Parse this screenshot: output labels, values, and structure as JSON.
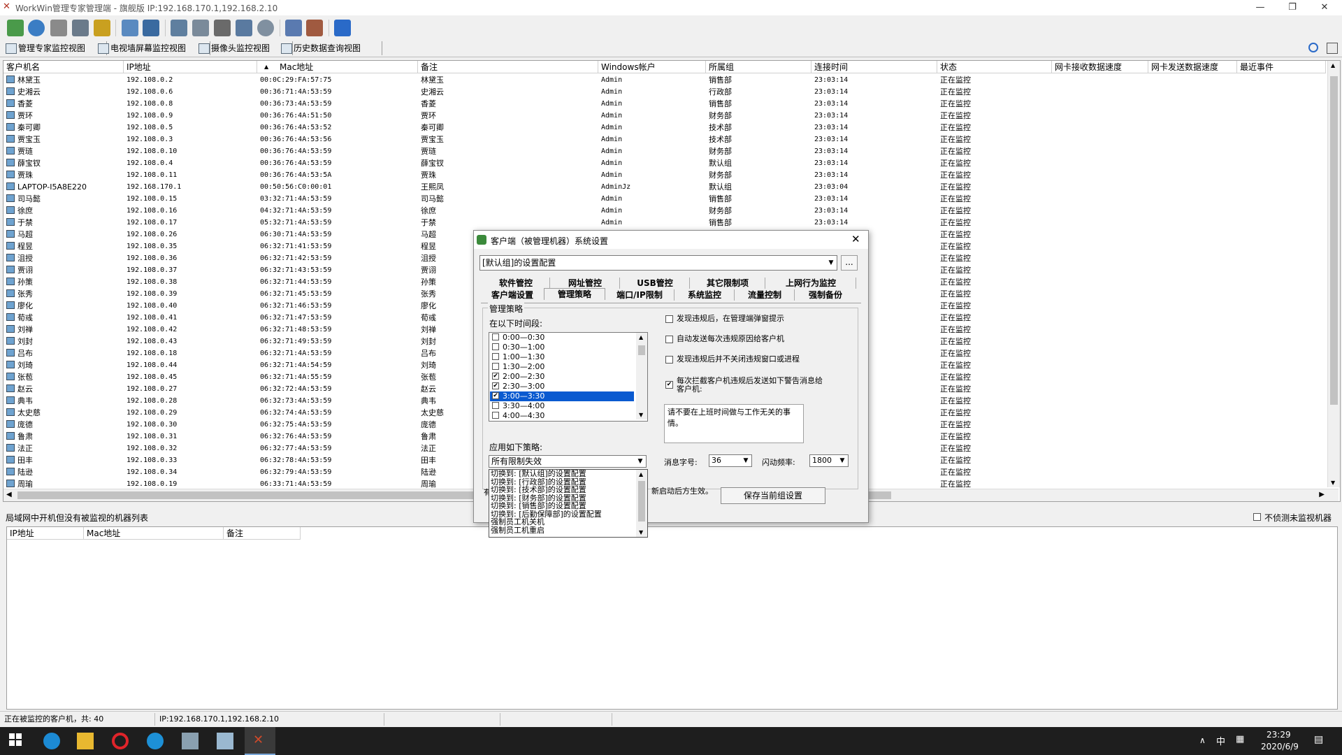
{
  "window": {
    "title": "WorkWin管理专家管理端 - 旗舰版 IP:192.168.170.1,192.168.2.10"
  },
  "view_tabs": [
    "管理专家监控视图",
    "电视墙屏幕监控视图",
    "摄像头监控视图",
    "历史数据查询视图"
  ],
  "columns": [
    "客户机名",
    "IP地址",
    "Mac地址",
    "备注",
    "Windows帐户",
    "所属组",
    "连接时间",
    "状态",
    "网卡接收数据速度",
    "网卡发送数据速度",
    "最近事件"
  ],
  "rows": [
    [
      "林黛玉",
      "192.108.0.2",
      "00:0C:29:FA:57:75",
      "林黛玉",
      "Admin",
      "销售部",
      "23:03:14",
      "正在监控"
    ],
    [
      "史湘云",
      "192.108.0.6",
      "00:36:71:4A:53:59",
      "史湘云",
      "Admin",
      "行政部",
      "23:03:14",
      "正在监控"
    ],
    [
      "香菱",
      "192.108.0.8",
      "00:36:73:4A:53:59",
      "香菱",
      "Admin",
      "销售部",
      "23:03:14",
      "正在监控"
    ],
    [
      "贾环",
      "192.108.0.9",
      "00:36:76:4A:51:50",
      "贾环",
      "Admin",
      "财务部",
      "23:03:14",
      "正在监控"
    ],
    [
      "秦可卿",
      "192.108.0.5",
      "00:36:76:4A:53:52",
      "秦可卿",
      "Admin",
      "技术部",
      "23:03:14",
      "正在监控"
    ],
    [
      "贾宝玉",
      "192.108.0.3",
      "00:36:76:4A:53:56",
      "贾宝玉",
      "Admin",
      "技术部",
      "23:03:14",
      "正在监控"
    ],
    [
      "贾琏",
      "192.108.0.10",
      "00:36:76:4A:53:59",
      "贾琏",
      "Admin",
      "财务部",
      "23:03:14",
      "正在监控"
    ],
    [
      "薛宝钗",
      "192.108.0.4",
      "00:36:76:4A:53:59",
      "薛宝钗",
      "Admin",
      "默认组",
      "23:03:14",
      "正在监控"
    ],
    [
      "贾珠",
      "192.108.0.11",
      "00:36:76:4A:53:5A",
      "贾珠",
      "Admin",
      "财务部",
      "23:03:14",
      "正在监控"
    ],
    [
      "LAPTOP-I5A8E220",
      "192.168.170.1",
      "00:50:56:C0:00:01",
      "王熙凤",
      "AdminJz",
      "默认组",
      "23:03:04",
      "正在监控"
    ],
    [
      "司马懿",
      "192.108.0.15",
      "03:32:71:4A:53:59",
      "司马懿",
      "Admin",
      "销售部",
      "23:03:14",
      "正在监控"
    ],
    [
      "徐庶",
      "192.108.0.16",
      "04:32:71:4A:53:59",
      "徐庶",
      "Admin",
      "财务部",
      "23:03:14",
      "正在监控"
    ],
    [
      "于禁",
      "192.108.0.17",
      "05:32:71:4A:53:59",
      "于禁",
      "Admin",
      "销售部",
      "23:03:14",
      "正在监控"
    ],
    [
      "马超",
      "192.108.0.26",
      "06:30:71:4A:53:59",
      "马超",
      "",
      "",
      "",
      "正在监控"
    ],
    [
      "程昱",
      "192.108.0.35",
      "06:32:71:41:53:59",
      "程昱",
      "",
      "",
      "",
      "正在监控"
    ],
    [
      "沮授",
      "192.108.0.36",
      "06:32:71:42:53:59",
      "沮授",
      "",
      "",
      "",
      "正在监控"
    ],
    [
      "贾诩",
      "192.108.0.37",
      "06:32:71:43:53:59",
      "贾诩",
      "",
      "",
      "",
      "正在监控"
    ],
    [
      "孙策",
      "192.108.0.38",
      "06:32:71:44:53:59",
      "孙策",
      "",
      "",
      "",
      "正在监控"
    ],
    [
      "张秀",
      "192.108.0.39",
      "06:32:71:45:53:59",
      "张秀",
      "",
      "",
      "",
      "正在监控"
    ],
    [
      "廖化",
      "192.108.0.40",
      "06:32:71:46:53:59",
      "廖化",
      "",
      "",
      "",
      "正在监控"
    ],
    [
      "荀彧",
      "192.108.0.41",
      "06:32:71:47:53:59",
      "荀彧",
      "",
      "",
      "",
      "正在监控"
    ],
    [
      "刘禅",
      "192.108.0.42",
      "06:32:71:48:53:59",
      "刘禅",
      "",
      "",
      "",
      "正在监控"
    ],
    [
      "刘封",
      "192.108.0.43",
      "06:32:71:49:53:59",
      "刘封",
      "",
      "",
      "",
      "正在监控"
    ],
    [
      "吕布",
      "192.108.0.18",
      "06:32:71:4A:53:59",
      "吕布",
      "",
      "",
      "",
      "正在监控"
    ],
    [
      "刘琦",
      "192.108.0.44",
      "06:32:71:4A:54:59",
      "刘琦",
      "",
      "",
      "",
      "正在监控"
    ],
    [
      "张苞",
      "192.108.0.45",
      "06:32:71:4A:55:59",
      "张苞",
      "",
      "",
      "",
      "正在监控"
    ],
    [
      "赵云",
      "192.108.0.27",
      "06:32:72:4A:53:59",
      "赵云",
      "",
      "",
      "",
      "正在监控"
    ],
    [
      "典韦",
      "192.108.0.28",
      "06:32:73:4A:53:59",
      "典韦",
      "",
      "",
      "",
      "正在监控"
    ],
    [
      "太史慈",
      "192.108.0.29",
      "06:32:74:4A:53:59",
      "太史慈",
      "",
      "",
      "",
      "正在监控"
    ],
    [
      "庞德",
      "192.108.0.30",
      "06:32:75:4A:53:59",
      "庞德",
      "",
      "",
      "",
      "正在监控"
    ],
    [
      "鲁肃",
      "192.108.0.31",
      "06:32:76:4A:53:59",
      "鲁肃",
      "",
      "",
      "",
      "正在监控"
    ],
    [
      "法正",
      "192.108.0.32",
      "06:32:77:4A:53:59",
      "法正",
      "",
      "",
      "",
      "正在监控"
    ],
    [
      "田丰",
      "192.108.0.33",
      "06:32:78:4A:53:59",
      "田丰",
      "",
      "",
      "",
      "正在监控"
    ],
    [
      "陆逊",
      "192.108.0.34",
      "06:32:79:4A:53:59",
      "陆逊",
      "",
      "",
      "",
      "正在监控"
    ],
    [
      "周瑜",
      "192.108.0.19",
      "06:33:71:4A:53:59",
      "周瑜",
      "",
      "",
      "",
      "正在监控"
    ]
  ],
  "bottom": {
    "label": "局域网中开机但没有被监视的机器列表",
    "no_monitor_label": "不侦测未监视机器",
    "columns": [
      "IP地址",
      "Mac地址",
      "备注"
    ]
  },
  "status": {
    "count": "正在被监控的客户机，共: 40",
    "ip": "IP:192.168.170.1,192.168.2.10"
  },
  "taskbar": {
    "time": "23:29",
    "date": "2020/6/9",
    "ime": "中"
  },
  "dialog": {
    "title": "客户端（被管理机器）系统设置",
    "config_select": "[默认组]的设置配置",
    "more_button": "...",
    "tabs_row1": [
      "软件管控",
      "网址管控",
      "USB管控",
      "其它限制项",
      "上网行为监控"
    ],
    "tabs_row2": [
      "客户端设置",
      "管理策略",
      "端口/IP限制",
      "系统监控",
      "流量控制",
      "强制备份"
    ],
    "group_title": "管理策略",
    "time_label": "在以下时间段:",
    "time_slots": [
      {
        "label": "0:00—0:30",
        "checked": false
      },
      {
        "label": "0:30—1:00",
        "checked": false
      },
      {
        "label": "1:00—1:30",
        "checked": false
      },
      {
        "label": "1:30—2:00",
        "checked": false
      },
      {
        "label": "2:00—2:30",
        "checked": true
      },
      {
        "label": "2:30—3:00",
        "checked": true
      },
      {
        "label": "3:00—3:30",
        "checked": true
      },
      {
        "label": "3:30—4:00",
        "checked": false
      },
      {
        "label": "4:00—4:30",
        "checked": false
      }
    ],
    "apply_label": "应用如下策略:",
    "policy_select": "所有限制失效",
    "policy_options": [
      "切换到: [默认组]的设置配置",
      "切换到: [行政部]的设置配置",
      "切换到: [技术部]的设置配置",
      "切换到: [财务部]的设置配置",
      "切换到: [销售部]的设置配置",
      "切换到: [后勤保障部]的设置配置",
      "强制员工机关机",
      "强制员工机重启"
    ],
    "options": [
      {
        "label": "发现违规后，在管理端弹窗提示",
        "checked": false
      },
      {
        "label": "自动发送每次违规原因给客户机",
        "checked": false
      },
      {
        "label": "发现违规后并不关闭违规窗口或进程",
        "checked": false
      },
      {
        "label": "每次拦截客户机违规后发送如下警告消息给客户机:",
        "checked": true
      }
    ],
    "message": "请不要在上班时间做与工作无关的事情。",
    "font_label": "消息字号:",
    "font_value": "36",
    "flash_label": "闪动频率:",
    "flash_value": "1800",
    "partial_left": "有",
    "note_partial": "新启动后方生效。",
    "save_button": "保存当前组设置"
  }
}
